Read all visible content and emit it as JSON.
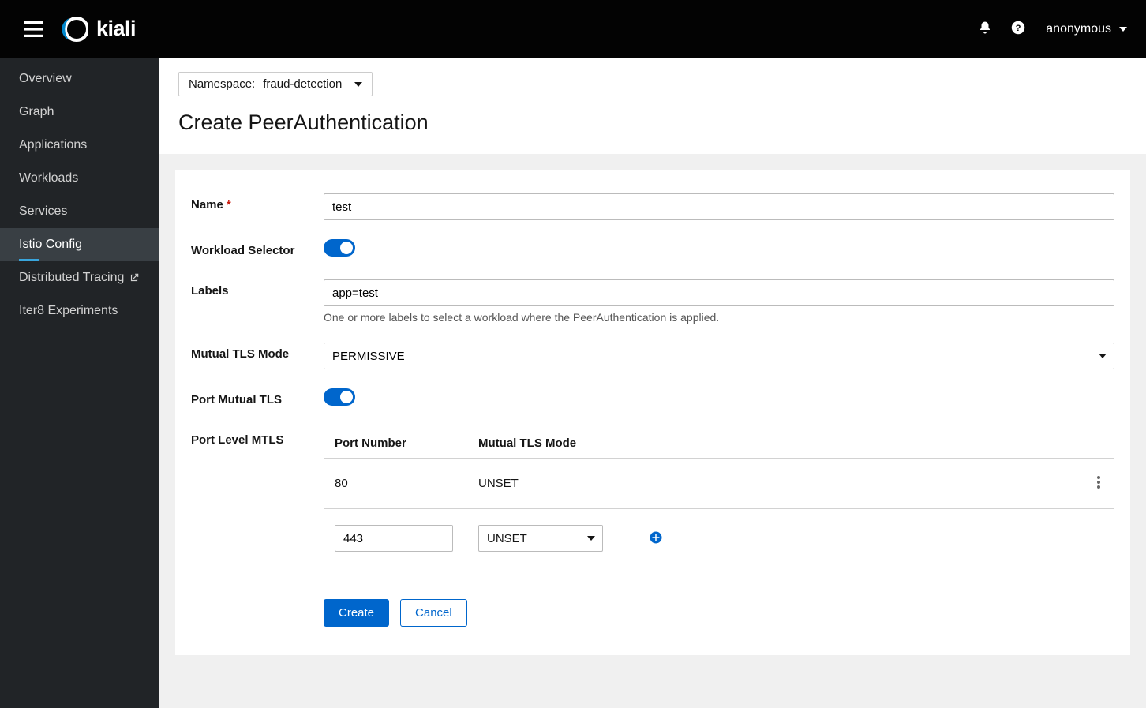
{
  "app": {
    "name": "kiali"
  },
  "user": {
    "name": "anonymous"
  },
  "sidebar": {
    "items": [
      {
        "label": "Overview"
      },
      {
        "label": "Graph"
      },
      {
        "label": "Applications"
      },
      {
        "label": "Workloads"
      },
      {
        "label": "Services"
      },
      {
        "label": "Istio Config"
      },
      {
        "label": "Distributed Tracing"
      },
      {
        "label": "Iter8 Experiments"
      }
    ]
  },
  "page": {
    "namespace_label": "Namespace:",
    "namespace_value": "fraud-detection",
    "title": "Create PeerAuthentication"
  },
  "form": {
    "name": {
      "label": "Name",
      "value": "test"
    },
    "workload_selector": {
      "label": "Workload Selector",
      "on": true
    },
    "labels": {
      "label": "Labels",
      "value": "app=test",
      "help": "One or more labels to select a workload where the PeerAuthentication is applied."
    },
    "mtls_mode": {
      "label": "Mutual TLS Mode",
      "value": "PERMISSIVE"
    },
    "port_mtls": {
      "label": "Port Mutual TLS",
      "on": true
    },
    "port_level": {
      "label": "Port Level MTLS",
      "columns": {
        "port": "Port Number",
        "mode": "Mutual TLS Mode"
      },
      "rows": [
        {
          "port": "80",
          "mode": "UNSET"
        }
      ],
      "new_row": {
        "port": "443",
        "mode": "UNSET"
      }
    },
    "buttons": {
      "create": "Create",
      "cancel": "Cancel"
    }
  }
}
